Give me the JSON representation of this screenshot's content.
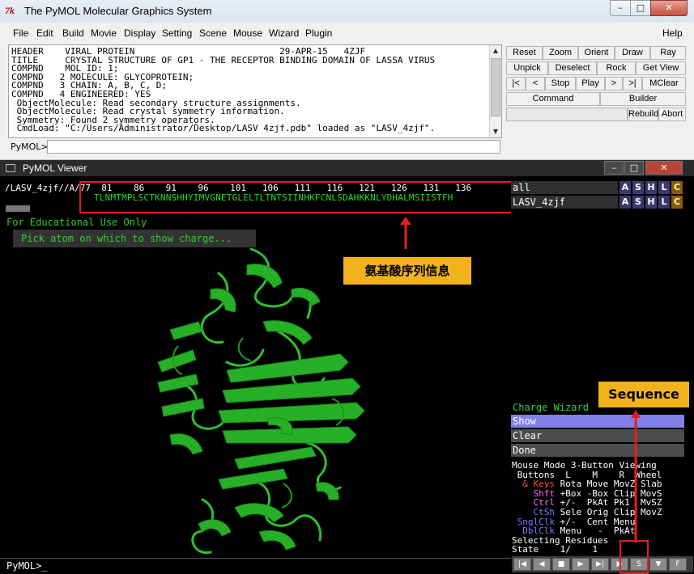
{
  "window": {
    "title": "The PyMOL Molecular Graphics System",
    "tk_logo": "7k"
  },
  "window_controls": {
    "minimize": "–",
    "maximize": "□",
    "close": "✕"
  },
  "menu": [
    "File",
    "Edit",
    "Build",
    "Movie",
    "Display",
    "Setting",
    "Scene",
    "Mouse",
    "Wizard",
    "Plugin",
    "Help"
  ],
  "console": {
    "lines": [
      "HEADER    VIRAL PROTEIN                           29-APR-15   4ZJF",
      "TITLE     CRYSTAL STRUCTURE OF GP1 - THE RECEPTOR BINDING DOMAIN OF LASSA VIRUS",
      "COMPND    MOL_ID: 1;",
      "COMPND   2 MOLECULE: GLYCOPROTEIN;",
      "COMPND   3 CHAIN: A, B, C, D;",
      "COMPND   4 ENGINEERED: YES",
      " ObjectMolecule: Read secondary structure assignments.",
      " ObjectMolecule: Read crystal symmetry information.",
      " Symmetry: Found 2 symmetry operators.",
      " CmdLoad: \"C:/Users/Administrator/Desktop/LASV 4zjf.pdb\" loaded as \"LASV_4zjf\"."
    ],
    "prompt": "PyMOL>",
    "input_value": ""
  },
  "buttons": {
    "row1": [
      "Reset",
      "Zoom",
      "Orient",
      "Draw",
      "Ray"
    ],
    "row2": [
      "Unpick",
      "Deselect",
      "Rock",
      "Get View"
    ],
    "row3": [
      "|<",
      "<",
      "Stop",
      "Play",
      ">",
      ">|",
      "MClear"
    ],
    "command": "Command",
    "builder": "Builder",
    "rebuild": "Rebuild",
    "abort": "Abort"
  },
  "viewer": {
    "title": "PyMOL Viewer",
    "seq_header": "/LASV_4zjf//A/77  81    86    91    96    101   106   111   116   121   126   131   136",
    "seq_letters": "TLNMTMPLSCTKNNSHHYIMVGNETGLELTLTNTSIINHKFCNLSDAHKKNLYDHALMSIISTFH",
    "edu_text": "For Educational Use Only",
    "pick_text": "Pick atom on which to show charge...",
    "annotation_cn": "氨基酸序列信息",
    "prompt": "PyMOL>_"
  },
  "objects": [
    {
      "name": "all",
      "btns": [
        "A",
        "S",
        "H",
        "L",
        "C"
      ]
    },
    {
      "name": "LASV_4zjf",
      "btns": [
        "A",
        "S",
        "H",
        "L",
        "C"
      ]
    }
  ],
  "wizard": {
    "title": "Charge Wizard",
    "items": [
      "Show",
      "Clear",
      "Done"
    ]
  },
  "annotation_sequence": "Sequence",
  "mouse": {
    "title": "Mouse Mode 3-Button Viewing",
    "header": " Buttons  L    M    R  Wheel",
    "keys_label": "  & Keys",
    "keys_values": " Rota Move MovZ Slab",
    "shft_label": "    Shft",
    "shft_values": " +Box -Box Clip MovS",
    "ctrl_label": "    Ctrl",
    "ctrl_values": " +/-  PkAt Pk1  MvSZ",
    "ctsh_label": "    CtSh",
    "ctsh_values": " Sele Orig Clip MovZ",
    "snglclk_label": " SnglClk",
    "snglclk_values": " +/-  Cent Menu",
    "dblclk_label": "  DblClk",
    "dblclk_values": " Menu   -  PkAt",
    "selecting": "Selecting Residues",
    "state": "State    1/    1"
  },
  "playbar": [
    "|◀",
    "◀",
    "■",
    "▶",
    "▶|",
    "▶",
    "S",
    "▼",
    "F"
  ],
  "colors": {
    "seq_green": "#20dc20",
    "highlight_red": "#e02020",
    "label_orange": "#f2b21c",
    "wizard_show": "#8080e8"
  }
}
